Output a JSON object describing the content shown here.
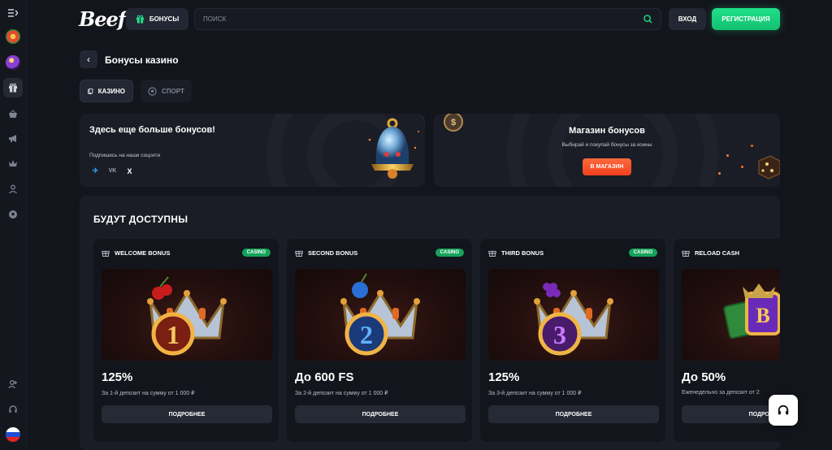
{
  "header": {
    "logo": "Beef",
    "bonus_label": "БОНУСЫ",
    "search_placeholder": "ПОИСК",
    "login_label": "ВХОД",
    "register_label": "РЕГИСТРАЦИЯ"
  },
  "page": {
    "title": "Бонусы казино"
  },
  "tabs": [
    {
      "label": "КАЗИНО",
      "active": true
    },
    {
      "label": "СПОРТ",
      "active": false
    }
  ],
  "promo_left": {
    "title": "Здесь еще больше бонусов!",
    "subtitle": "Подпишись на наши соцсети",
    "socials": [
      "telegram-icon",
      "vk-icon",
      "x-icon"
    ],
    "social_labels": [
      "✈",
      "VK",
      "X"
    ]
  },
  "promo_right": {
    "title": "Магазин бонусов",
    "subtitle": "Выбирай и покупай бонусы за коины",
    "button": "В МАГАЗИН"
  },
  "section": {
    "title": "БУДУТ ДОСТУПНЫ",
    "cards": [
      {
        "name": "WELCOME BONUS",
        "badge": "CASINO",
        "amount": "125%",
        "desc": "За 1-й депозит на сумму от 1 000 ₽",
        "button": "ПОДРОБНЕЕ",
        "numeral": "1"
      },
      {
        "name": "SECOND BONUS",
        "badge": "CASINO",
        "amount": "До 600 FS",
        "desc": "За 2-й депозит на сумму от 1 000 ₽",
        "button": "ПОДРОБНЕЕ",
        "numeral": "2"
      },
      {
        "name": "THIRD BONUS",
        "badge": "CASINO",
        "amount": "125%",
        "desc": "За 3-й депозит на сумму от 1 000 ₽",
        "button": "ПОДРОБНЕЕ",
        "numeral": "3"
      },
      {
        "name": "RELOAD CASH",
        "badge": "",
        "amount": "До 50%",
        "desc": "Еженедельно за депозит от 2",
        "button": "ПОДРОБНЕЕ",
        "numeral": ""
      }
    ]
  },
  "colors": {
    "accent_green": "#1fe08a",
    "accent_orange": "#f0401c",
    "bg": "#13151c",
    "panel": "#1a1d26"
  }
}
